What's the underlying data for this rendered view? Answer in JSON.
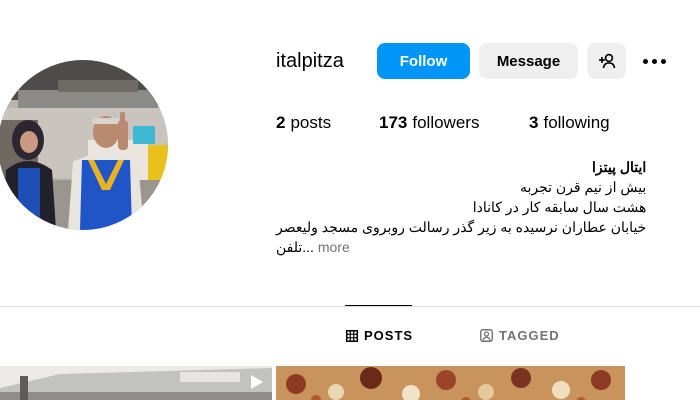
{
  "profile": {
    "username": "italpitza",
    "follow_label": "Follow",
    "message_label": "Message"
  },
  "stats": {
    "posts_count": "2",
    "posts_label": "posts",
    "followers_count": "173",
    "followers_label": "followers",
    "following_count": "3",
    "following_label": "following"
  },
  "bio": {
    "name": "ایتال پیتزا",
    "lines": [
      "بیش از نیم قرن تجربه",
      "هشت سال سابقه کار در کانادا",
      "خیابان عطاران نرسیده به زیر گذر رسالت روبروی مسجد ولیعصر"
    ],
    "last_line": "تلفن...",
    "more_label": "more"
  },
  "tabs": {
    "posts_label": "POSTS",
    "tagged_label": "TAGGED"
  },
  "colors": {
    "accent": "#0095f6",
    "button_grey": "#efefef",
    "muted_text": "#737373",
    "divider": "#dbdbdb"
  },
  "icons": {
    "add_user": "add-user-icon",
    "more": "more-options-icon",
    "grid": "grid-icon",
    "tagged": "tagged-icon",
    "reel": "reel-icon"
  }
}
